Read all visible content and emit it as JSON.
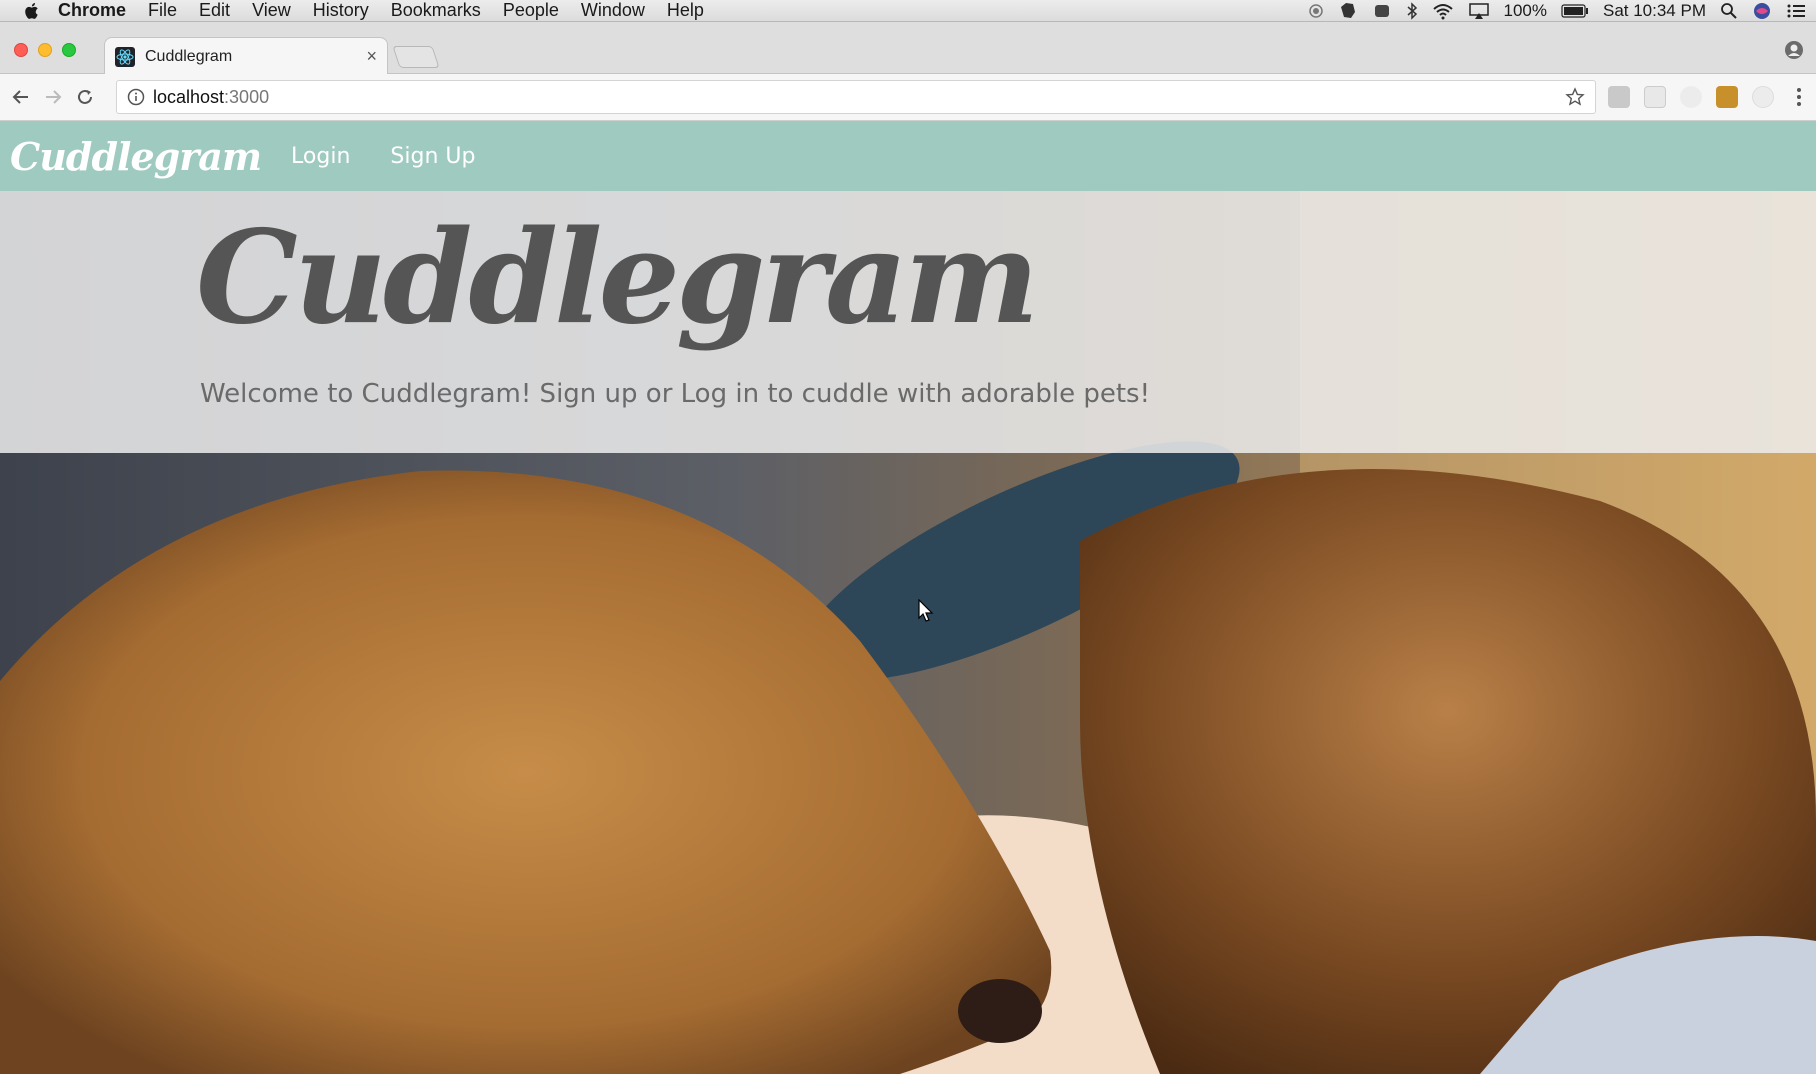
{
  "menubar": {
    "app": "Chrome",
    "menus": [
      "File",
      "Edit",
      "View",
      "History",
      "Bookmarks",
      "People",
      "Window",
      "Help"
    ],
    "battery": "100%",
    "clock": "Sat 10:34 PM"
  },
  "browser": {
    "tab_title": "Cuddlegram",
    "url_host": "localhost",
    "url_port": ":3000"
  },
  "app": {
    "brand": "Cuddlegram",
    "nav": {
      "login": "Login",
      "signup": "Sign Up"
    },
    "hero": {
      "title": "Cuddlegram",
      "subtitle": "Welcome to Cuddlegram! Sign up or Log in to cuddle with adorable pets!"
    },
    "nav_color": "#9fcac0"
  }
}
